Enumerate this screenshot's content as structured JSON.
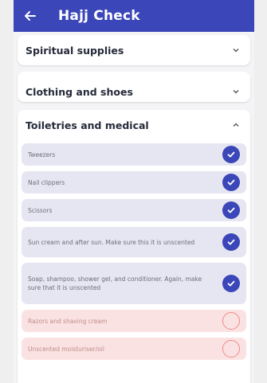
{
  "appbar": {
    "title": "Hajj Check",
    "back_icon": "arrow-left-icon"
  },
  "sections": [
    {
      "title": "Spiritual supplies",
      "expanded": false
    },
    {
      "title": "Clothing and shoes",
      "expanded": false
    },
    {
      "title": "Toiletries and medical",
      "expanded": true
    }
  ],
  "toiletries_items": [
    {
      "label": "Tweezers",
      "checked": true
    },
    {
      "label": "Nail clippers",
      "checked": true
    },
    {
      "label": "Scissors",
      "checked": true
    },
    {
      "label": "Sun cream and after sun. Make sure this it is unscented",
      "checked": true
    },
    {
      "label": "Soap, shampoo, shower gel, and conditioner. Again, make sure that it is unscented",
      "checked": true
    },
    {
      "label": "Razors and shaving cream",
      "checked": false
    },
    {
      "label": "Unscented moisturiser/oil",
      "checked": false
    }
  ],
  "colors": {
    "primary": "#3b46b8",
    "checked_bg": "#e6e6f2",
    "unchecked_bg": "#fbe2e2",
    "unchecked_border": "#f08a8a"
  }
}
